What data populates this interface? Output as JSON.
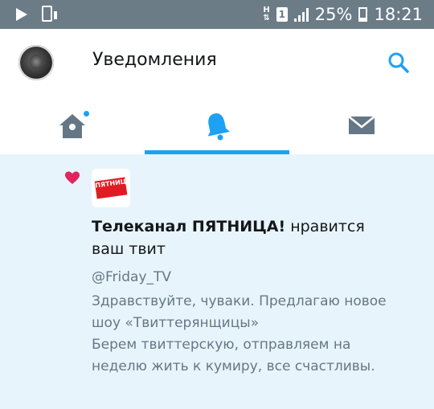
{
  "status_bar": {
    "battery": "25%",
    "time": "18:21",
    "network_letter": "H",
    "sim_label": "1"
  },
  "header": {
    "title": "Уведомления"
  },
  "tabs": [
    {
      "name": "home",
      "active": false,
      "has_dot": true
    },
    {
      "name": "notifications",
      "active": true,
      "has_dot": false
    },
    {
      "name": "messages",
      "active": false,
      "has_dot": false
    }
  ],
  "notification": {
    "account_name": "Телеканал ПЯТНИЦА!",
    "action_text": "нравится ваш твит",
    "handle": "@Friday_TV",
    "tweet_text": "Здравствуйте, чуваки. Предлагаю новое шоу «Твиттерянщицы»\nБерем твиттерскую, отправляем на неделю жить к кумиру, все счастливы.",
    "logo_text": "ПЯТНИЦА!"
  },
  "colors": {
    "accent": "#1da1f2",
    "status_bar": "#6b7c87",
    "heart": "#e0245e",
    "item_bg": "#e8f4fb",
    "icon_gray": "#657786"
  }
}
